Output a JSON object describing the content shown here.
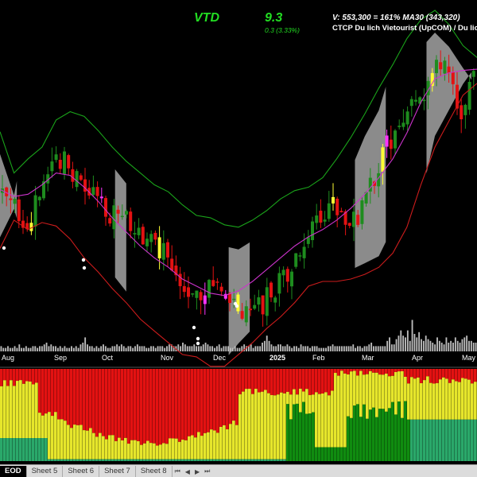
{
  "header": {
    "ticker": "VTD",
    "price": "9.3",
    "change": "0.3 (3.33%)",
    "volume_text": "V: 553,300 = 161%  MA30 (343,320)",
    "company": "CTCP Du lich Vietourist (UpCOM) / Du lich"
  },
  "colors": {
    "up": "#1e8c1e",
    "down": "#e31212",
    "up_alert": "#ffff33",
    "down_alert": "#ff33ff",
    "cyan": "#33ffff",
    "band_upper": "#1aa31a",
    "band_lower": "#cc1c1c",
    "ma": "#cc33cc",
    "fill": "#9a9a9a"
  },
  "tabs": [
    "EOD",
    "Sheet 5",
    "Sheet 6",
    "Sheet 7",
    "Sheet 8"
  ],
  "chart_data": {
    "type": "line",
    "x_ticks": [
      "Aug",
      "Sep",
      "Oct",
      "Nov",
      "Dec",
      "2025",
      "Feb",
      "Mar",
      "Apr",
      "May"
    ],
    "y_range": [
      6.6,
      9.5
    ],
    "series": [
      {
        "values": [
          8.45,
          8.1,
          8.22,
          8.32,
          8.55,
          8.62,
          8.58,
          8.46,
          8.32,
          8.2,
          8.1,
          8.0,
          7.94,
          7.83,
          7.74,
          7.72,
          7.66,
          7.64,
          7.7,
          7.78,
          7.88,
          7.95,
          7.98,
          8.06,
          8.22,
          8.4,
          8.6,
          8.82,
          9.02,
          9.24,
          9.4,
          9.48,
          9.36,
          9.18,
          9.08
        ]
      },
      {
        "values": [
          7.96,
          7.9,
          7.92,
          8.0,
          8.1,
          8.08,
          7.98,
          7.86,
          7.72,
          7.6,
          7.48,
          7.38,
          7.3,
          7.2,
          7.14,
          7.08,
          7.06,
          7.1,
          7.18,
          7.28,
          7.38,
          7.48,
          7.56,
          7.62,
          7.7,
          7.8,
          7.92,
          8.06,
          8.22,
          8.44,
          8.7,
          8.9,
          8.95,
          8.97,
          8.98
        ]
      },
      {
        "values": [
          7.46,
          7.7,
          7.62,
          7.68,
          7.65,
          7.54,
          7.38,
          7.26,
          7.12,
          7.0,
          6.86,
          6.76,
          6.66,
          6.56,
          6.54,
          6.46,
          6.46,
          6.56,
          6.66,
          6.78,
          6.88,
          7.0,
          7.14,
          7.18,
          7.18,
          7.2,
          7.24,
          7.3,
          7.42,
          7.64,
          8.0,
          8.32,
          8.54,
          8.76,
          8.86
        ]
      }
    ],
    "price_path": [
      7.9,
      7.8,
      7.7,
      7.9,
      8.3,
      8.1,
      7.95,
      7.85,
      7.75,
      7.7,
      7.55,
      7.5,
      7.35,
      7.2,
      7.1,
      7.15,
      7.0,
      6.95,
      6.85,
      7.05,
      7.15,
      7.3,
      7.6,
      7.75,
      7.85,
      7.7,
      7.8,
      8.2,
      8.4,
      8.6,
      8.7,
      9.1,
      8.9,
      8.6,
      9.0
    ],
    "volume_bars": [
      3,
      2,
      2,
      3,
      2,
      2,
      3,
      2,
      4,
      2,
      2,
      3,
      2,
      2,
      3,
      3,
      2,
      3,
      3,
      4,
      5,
      3,
      4,
      3,
      3,
      2,
      3,
      2,
      3,
      2,
      2,
      3,
      2,
      3,
      2,
      4,
      5,
      8,
      4,
      3,
      3,
      2,
      3,
      2,
      3,
      4,
      3,
      2,
      2,
      3,
      3,
      4,
      3,
      4,
      3,
      2,
      3,
      3,
      2,
      3,
      4,
      3,
      3,
      3,
      2,
      2,
      3,
      3,
      2,
      3,
      3,
      3,
      2,
      3,
      4,
      4,
      3,
      3,
      4,
      3,
      5,
      4,
      3,
      3,
      3,
      4,
      3,
      3,
      3,
      4,
      5,
      4,
      3,
      3,
      2,
      3,
      4,
      2,
      3,
      3,
      3,
      2,
      2,
      3,
      2,
      2,
      3,
      4,
      3,
      3,
      4,
      2,
      3,
      3,
      3,
      5,
      6,
      9,
      6,
      4,
      3,
      3,
      4,
      4,
      3,
      3,
      4,
      3,
      2,
      3,
      3,
      2,
      4,
      3,
      3,
      3,
      2,
      3,
      3,
      3,
      2,
      2,
      2,
      2,
      3,
      3,
      4,
      3,
      3,
      3,
      3,
      3,
      3,
      3,
      3,
      4,
      2,
      3,
      3,
      2,
      3,
      3,
      4,
      5,
      3,
      3,
      3,
      3,
      3,
      3,
      6,
      8,
      4,
      4,
      7,
      9,
      12,
      9,
      8,
      12,
      6,
      18,
      10,
      8,
      11,
      7,
      6,
      9,
      7,
      6,
      5,
      4,
      8,
      6,
      5,
      4,
      8,
      5,
      6,
      5,
      8,
      6,
      5,
      7,
      8,
      9,
      6,
      6,
      5,
      5
    ]
  }
}
